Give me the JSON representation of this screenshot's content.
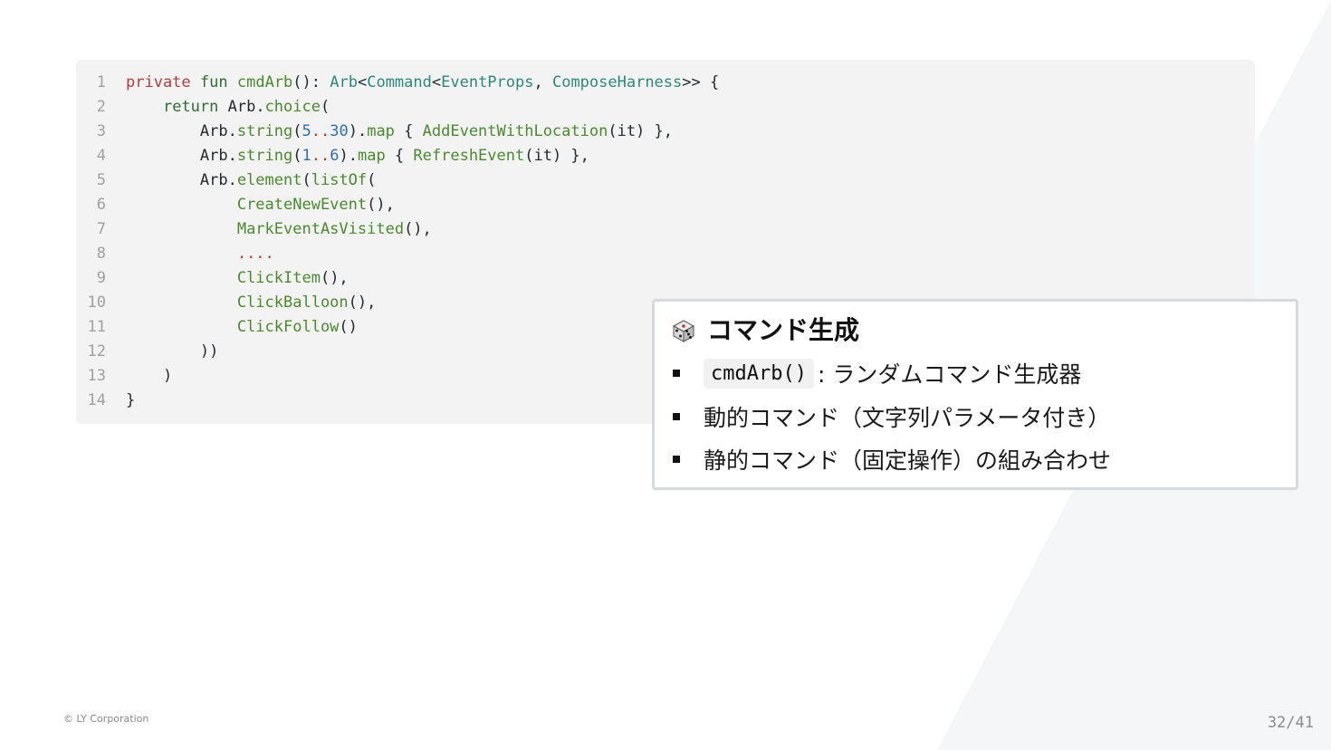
{
  "code": {
    "line_numbers": [
      "1",
      "2",
      "3",
      "4",
      "5",
      "6",
      "7",
      "8",
      "9",
      "10",
      "11",
      "12",
      "13",
      "14"
    ],
    "lines": [
      [
        {
          "t": "private",
          "c": "kw"
        },
        {
          "t": " ",
          "c": "plain"
        },
        {
          "t": "fun",
          "c": "kw2"
        },
        {
          "t": " ",
          "c": "plain"
        },
        {
          "t": "cmdArb",
          "c": "fn"
        },
        {
          "t": "(): ",
          "c": "plain"
        },
        {
          "t": "Arb",
          "c": "ty"
        },
        {
          "t": "<",
          "c": "plain"
        },
        {
          "t": "Command",
          "c": "ty"
        },
        {
          "t": "<",
          "c": "plain"
        },
        {
          "t": "EventProps",
          "c": "ty"
        },
        {
          "t": ", ",
          "c": "plain"
        },
        {
          "t": "ComposeHarness",
          "c": "ty"
        },
        {
          "t": ">> {",
          "c": "plain"
        }
      ],
      [
        {
          "t": "    ",
          "c": "plain"
        },
        {
          "t": "return",
          "c": "kw2"
        },
        {
          "t": " Arb.",
          "c": "plain"
        },
        {
          "t": "choice",
          "c": "fn"
        },
        {
          "t": "(",
          "c": "plain"
        }
      ],
      [
        {
          "t": "        Arb.",
          "c": "plain"
        },
        {
          "t": "string",
          "c": "fn"
        },
        {
          "t": "(",
          "c": "plain"
        },
        {
          "t": "5",
          "c": "num"
        },
        {
          "t": "..",
          "c": "dots"
        },
        {
          "t": "30",
          "c": "num"
        },
        {
          "t": ").",
          "c": "plain"
        },
        {
          "t": "map",
          "c": "fn"
        },
        {
          "t": " { ",
          "c": "plain"
        },
        {
          "t": "AddEventWithLocation",
          "c": "fn"
        },
        {
          "t": "(it) },",
          "c": "plain"
        }
      ],
      [
        {
          "t": "        Arb.",
          "c": "plain"
        },
        {
          "t": "string",
          "c": "fn"
        },
        {
          "t": "(",
          "c": "plain"
        },
        {
          "t": "1",
          "c": "num"
        },
        {
          "t": "..",
          "c": "dots"
        },
        {
          "t": "6",
          "c": "num"
        },
        {
          "t": ").",
          "c": "plain"
        },
        {
          "t": "map",
          "c": "fn"
        },
        {
          "t": " { ",
          "c": "plain"
        },
        {
          "t": "RefreshEvent",
          "c": "fn"
        },
        {
          "t": "(it) },",
          "c": "plain"
        }
      ],
      [
        {
          "t": "        Arb.",
          "c": "plain"
        },
        {
          "t": "element",
          "c": "fn"
        },
        {
          "t": "(",
          "c": "plain"
        },
        {
          "t": "listOf",
          "c": "fn"
        },
        {
          "t": "(",
          "c": "plain"
        }
      ],
      [
        {
          "t": "            ",
          "c": "plain"
        },
        {
          "t": "CreateNewEvent",
          "c": "fn"
        },
        {
          "t": "(),",
          "c": "plain"
        }
      ],
      [
        {
          "t": "            ",
          "c": "plain"
        },
        {
          "t": "MarkEventAsVisited",
          "c": "fn"
        },
        {
          "t": "(),",
          "c": "plain"
        }
      ],
      [
        {
          "t": "            ",
          "c": "plain"
        },
        {
          "t": "....",
          "c": "dots"
        }
      ],
      [
        {
          "t": "            ",
          "c": "plain"
        },
        {
          "t": "ClickItem",
          "c": "fn"
        },
        {
          "t": "(),",
          "c": "plain"
        }
      ],
      [
        {
          "t": "            ",
          "c": "plain"
        },
        {
          "t": "ClickBalloon",
          "c": "fn"
        },
        {
          "t": "(),",
          "c": "plain"
        }
      ],
      [
        {
          "t": "            ",
          "c": "plain"
        },
        {
          "t": "ClickFollow",
          "c": "fn"
        },
        {
          "t": "()",
          "c": "plain"
        }
      ],
      [
        {
          "t": "        ))",
          "c": "plain"
        }
      ],
      [
        {
          "t": "    )",
          "c": "plain"
        }
      ],
      [
        {
          "t": "}",
          "c": "plain"
        }
      ]
    ]
  },
  "callout": {
    "icon": "dice-icon",
    "title": "コマンド生成",
    "bullets": [
      {
        "code": "cmdArb()",
        "text": ": ランダムコマンド生成器"
      },
      {
        "code": "",
        "text": "動的コマンド（文字列パラメータ付き）"
      },
      {
        "code": "",
        "text": "静的コマンド（固定操作）の組み合わせ"
      }
    ]
  },
  "footer": {
    "copyright": "© LY Corporation",
    "page": "32/41"
  }
}
